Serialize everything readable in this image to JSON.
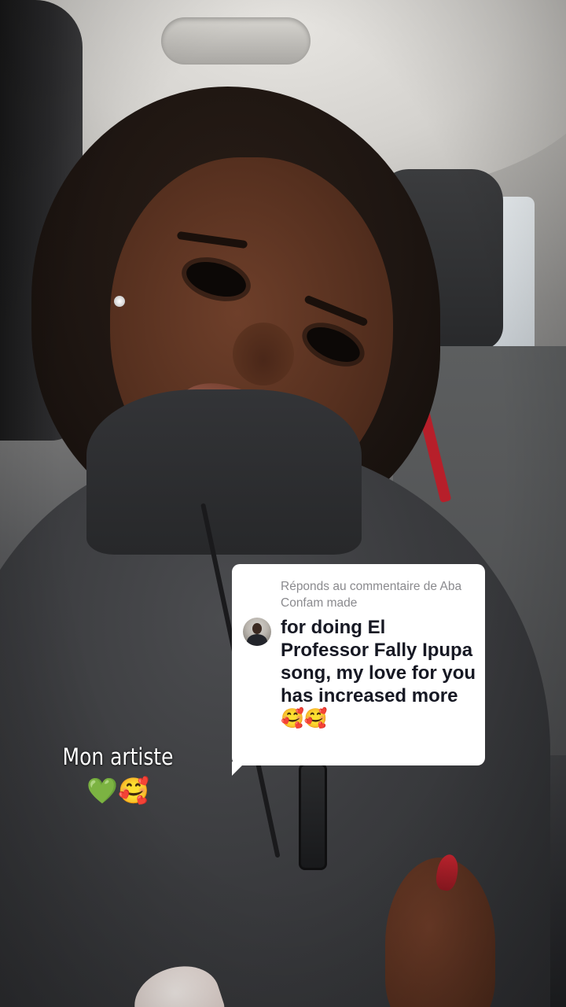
{
  "reply": {
    "header": "Réponds au commentaire de Aba Confam made",
    "body": "for doing El Professor Fally Ipupa song, my love for you has increased more🥰🥰"
  },
  "caption": {
    "line1": "Mon artiste",
    "line2": "💚🥰"
  },
  "icons": {
    "avatar": "commenter-avatar-icon"
  }
}
